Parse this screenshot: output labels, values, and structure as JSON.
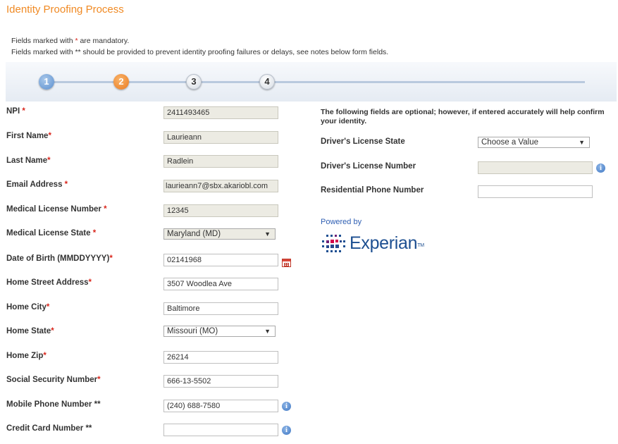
{
  "page": {
    "title": "Identity Proofing Process"
  },
  "notes": {
    "mandatory_prefix": "Fields marked with ",
    "mandatory_mark": "*",
    "mandatory_suffix": " are mandatory.",
    "recommended": "Fields marked with ** should be provided to prevent identity proofing failures or delays, see notes below form fields."
  },
  "steps": [
    {
      "label": "1",
      "state": "done"
    },
    {
      "label": "2",
      "state": "active"
    },
    {
      "label": "3",
      "state": "todo"
    },
    {
      "label": "4",
      "state": "todo"
    }
  ],
  "form": {
    "npi": {
      "label": "NPI",
      "marker": "*",
      "value": "2411493465"
    },
    "first_name": {
      "label": "First Name",
      "marker": "*",
      "value": "Laurieann"
    },
    "last_name": {
      "label": "Last Name",
      "marker": "*",
      "value": "Radlein"
    },
    "email": {
      "label": "Email Address",
      "marker": "*",
      "value": "laurieann7@sbx.akariobl.com"
    },
    "med_license_number": {
      "label": "Medical License Number",
      "marker": "*",
      "value": "12345"
    },
    "med_license_state": {
      "label": "Medical License State",
      "marker": "*",
      "value": "Maryland (MD)"
    },
    "dob": {
      "label": "Date of Birth (MMDDYYYY)",
      "marker": "*",
      "value": "02141968"
    },
    "street": {
      "label": "Home Street Address",
      "marker": "*",
      "value": "3507 Woodlea Ave"
    },
    "city": {
      "label": "Home City",
      "marker": "*",
      "value": "Baltimore"
    },
    "state": {
      "label": "Home State",
      "marker": "*",
      "value": "Missouri (MO)"
    },
    "zip": {
      "label": "Home Zip",
      "marker": "*",
      "value": "26214"
    },
    "ssn": {
      "label": "Social Security Number",
      "marker": "*",
      "value": "666-13-5502"
    },
    "mobile": {
      "label": "Mobile Phone Number **",
      "value": "(240) 688-7580"
    },
    "credit_card": {
      "label": "Credit Card Number **",
      "value": ""
    }
  },
  "optional": {
    "note": "The following fields are optional; however, if entered accurately will help confirm your identity.",
    "dl_state": {
      "label": "Driver's License State",
      "value": "Choose a Value"
    },
    "dl_number": {
      "label": "Driver's License Number",
      "value": ""
    },
    "res_phone": {
      "label": "Residential Phone Number",
      "value": ""
    }
  },
  "branding": {
    "powered_by": "Powered by",
    "logo_text": "Experian",
    "logo_tm": "TM"
  },
  "icons": {
    "info": "info-icon",
    "calendar": "calendar-icon",
    "dropdown": "dropdown-arrow-icon"
  },
  "colors": {
    "title": "#f08a24",
    "required": "#d9261c",
    "step_active": "#ea7a1f",
    "step_done": "#5b8fcf",
    "experian_blue": "#1d4f91"
  }
}
